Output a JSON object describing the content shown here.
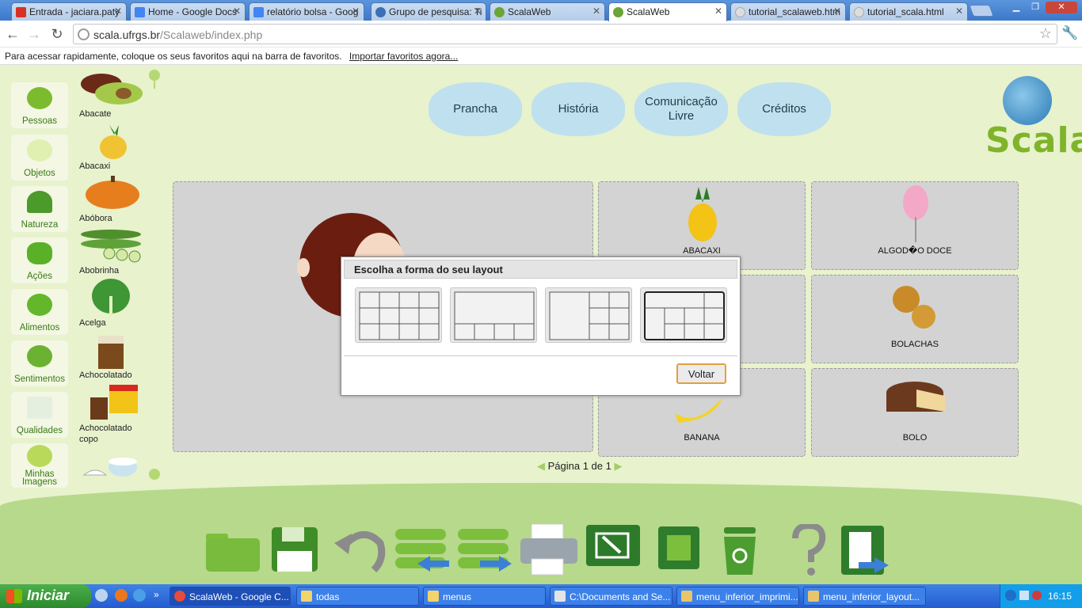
{
  "browser": {
    "tabs": [
      {
        "title": "Entrada - jaciara.paty",
        "icon": "gmail-icon",
        "color": "#d93025"
      },
      {
        "title": "Home - Google Docs",
        "icon": "docs-icon",
        "color": "#4285f4"
      },
      {
        "title": "relatório bolsa - Goog",
        "icon": "docs-icon",
        "color": "#4285f4"
      },
      {
        "title": "Grupo de pesquisa: Ti",
        "icon": "group-icon",
        "color": "#3b6fb6"
      },
      {
        "title": "ScalaWeb",
        "icon": "scala-icon",
        "color": "#6aa536"
      },
      {
        "title": "ScalaWeb",
        "icon": "scala-icon",
        "color": "#6aa536"
      },
      {
        "title": "tutorial_scalaweb.htm",
        "icon": "page-icon",
        "color": "#aaaaaa"
      },
      {
        "title": "tutorial_scala.html",
        "icon": "page-icon",
        "color": "#aaaaaa"
      }
    ],
    "url_host": "scala.ufrgs.br",
    "url_path": "/Scalaweb/index.php",
    "bookmarks_text": "Para acessar rapidamente, coloque os seus favoritos aqui na barra de favoritos.",
    "bookmarks_link": "Importar favoritos agora..."
  },
  "sidebar": {
    "categories": [
      "Pessoas",
      "Objetos",
      "Natureza",
      "Ações",
      "Alimentos",
      "Sentimentos",
      "Qualidades",
      "Minhas Imagens"
    ]
  },
  "thumbnails": [
    "Abacate",
    "Abacaxi",
    "Abóbora",
    "Abobrinha",
    "Acelga",
    "Achocolatado",
    "Achocolatado copo"
  ],
  "topmenu": [
    "Prancha",
    "História",
    "Comunicação Livre",
    "Créditos"
  ],
  "logo_text": "Scala",
  "board": {
    "cards": [
      "ABACAXI",
      "ALGOD�O DOCE",
      "",
      "BOLACHAS",
      "BANANA",
      "BOLO"
    ],
    "pager": "Página 1 de 1"
  },
  "dialog": {
    "title": "Escolha a forma do seu layout",
    "back_label": "Voltar"
  },
  "bottom_menu": [
    "open-folder-icon",
    "save-icon",
    "undo-icon",
    "previous-board-icon",
    "next-board-icon",
    "print-icon",
    "export-icon",
    "slideshow-icon",
    "trash-icon",
    "help-icon",
    "exit-icon"
  ],
  "taskbar": {
    "start_label": "Iniciar",
    "tasks": [
      "ScalaWeb - Google C...",
      "todas",
      "menus",
      "C:\\Documents and Se...",
      "menu_inferior_imprimi...",
      "menu_inferior_layout..."
    ],
    "clock": "16:15"
  }
}
